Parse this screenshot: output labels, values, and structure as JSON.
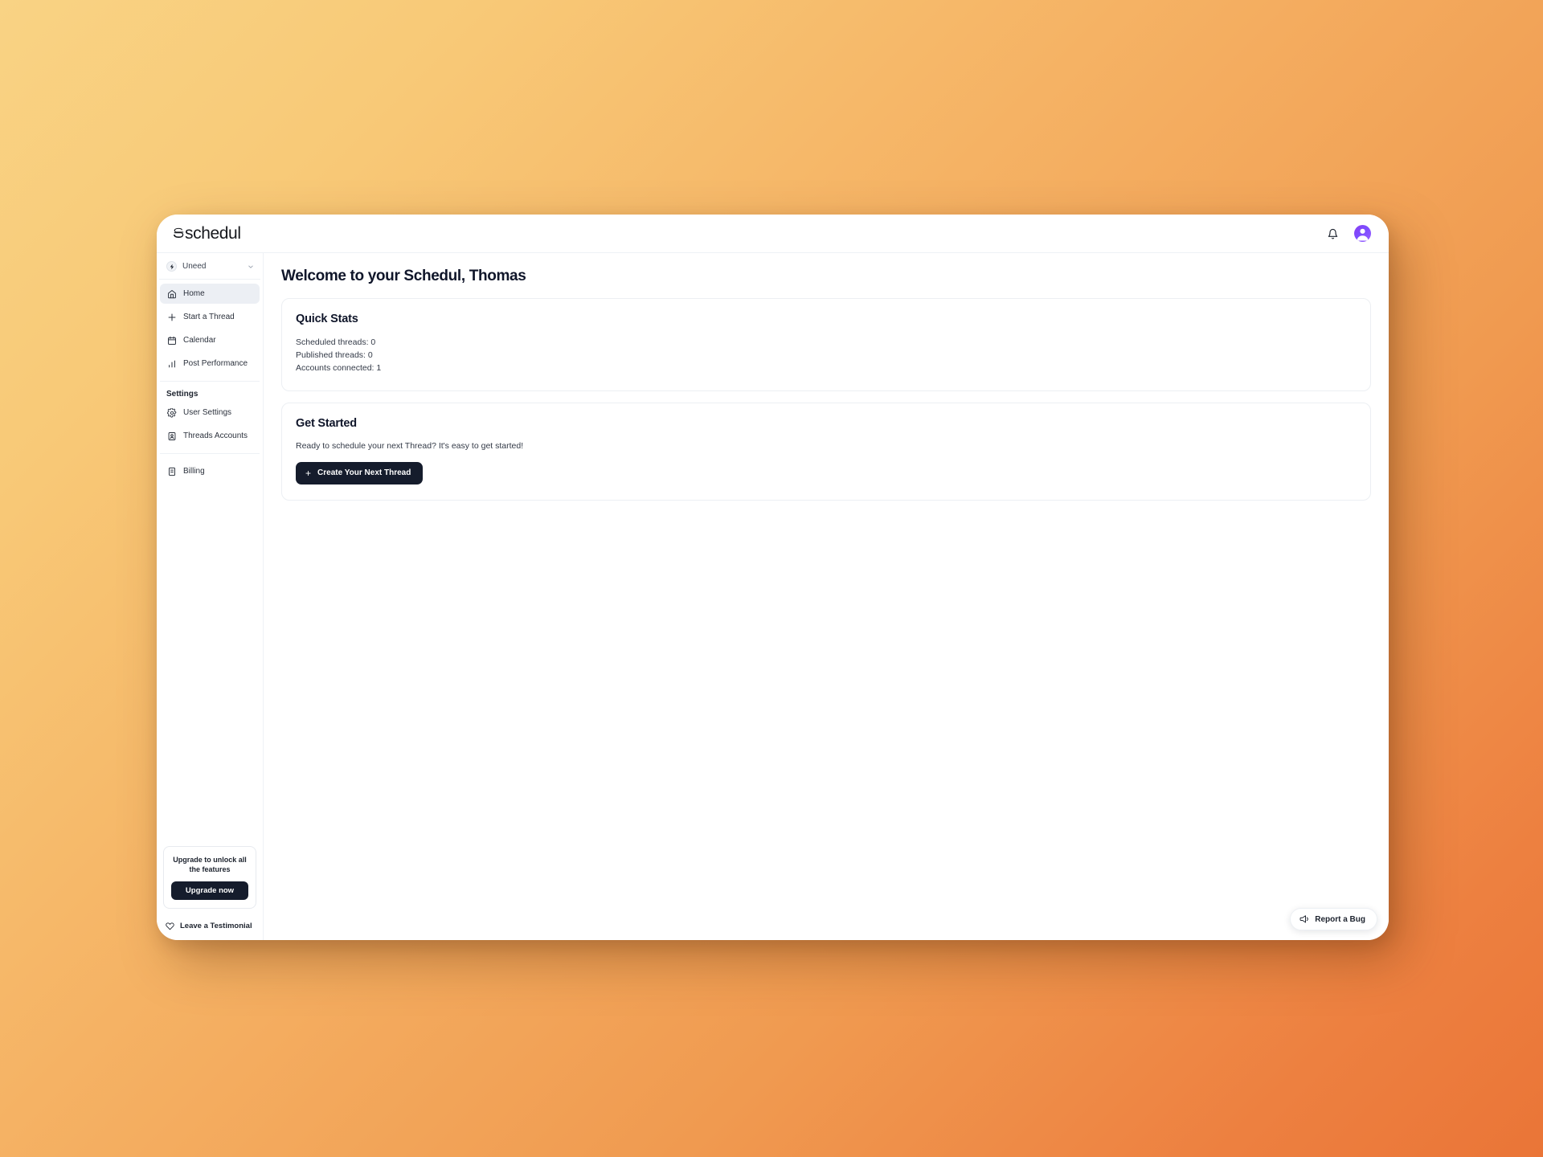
{
  "header": {
    "logo_text": "schedul",
    "logo_icon": "schedul-s-logo",
    "notifications_icon": "bell-icon",
    "avatar_icon": "user-avatar-icon"
  },
  "sidebar": {
    "workspace": {
      "name": "Uneed",
      "logo_icon": "lightning-bolt-icon",
      "chevron_icon": "chevron-down-icon"
    },
    "nav": [
      {
        "label": "Home",
        "icon": "home-icon",
        "active": true
      },
      {
        "label": "Start a Thread",
        "icon": "plus-icon",
        "active": false
      },
      {
        "label": "Calendar",
        "icon": "calendar-icon",
        "active": false
      },
      {
        "label": "Post Performance",
        "icon": "bar-chart-icon",
        "active": false
      }
    ],
    "settings_title": "Settings",
    "settings_nav": [
      {
        "label": "User Settings",
        "icon": "gear-icon",
        "active": false
      },
      {
        "label": "Threads Accounts",
        "icon": "threads-account-icon",
        "active": false
      }
    ],
    "billing_nav": [
      {
        "label": "Billing",
        "icon": "billing-card-icon",
        "active": false
      }
    ],
    "upgrade": {
      "text": "Upgrade to unlock all the features",
      "button_label": "Upgrade now"
    },
    "testimonial": {
      "label": "Leave a Testimonial",
      "icon": "heart-icon"
    }
  },
  "main": {
    "page_title": "Welcome to your Schedul, Thomas",
    "quick_stats": {
      "title": "Quick Stats",
      "lines": [
        "Scheduled threads: 0",
        "Published threads: 0",
        "Accounts connected: 1"
      ]
    },
    "get_started": {
      "title": "Get Started",
      "description": "Ready to schedule your next Thread? It's easy to get started!",
      "button_label": "Create Your Next Thread",
      "button_icon": "plus-icon"
    }
  },
  "report_bug": {
    "label": "Report a Bug",
    "icon": "megaphone-icon"
  },
  "colors": {
    "background_start": "#f9d384",
    "background_end": "#ea7537",
    "dark_button": "#151c2c",
    "active_nav": "#eceff4",
    "text_primary": "#10162a",
    "avatar_gradient_start": "#8b3df0",
    "avatar_gradient_end": "#9b5cff"
  }
}
